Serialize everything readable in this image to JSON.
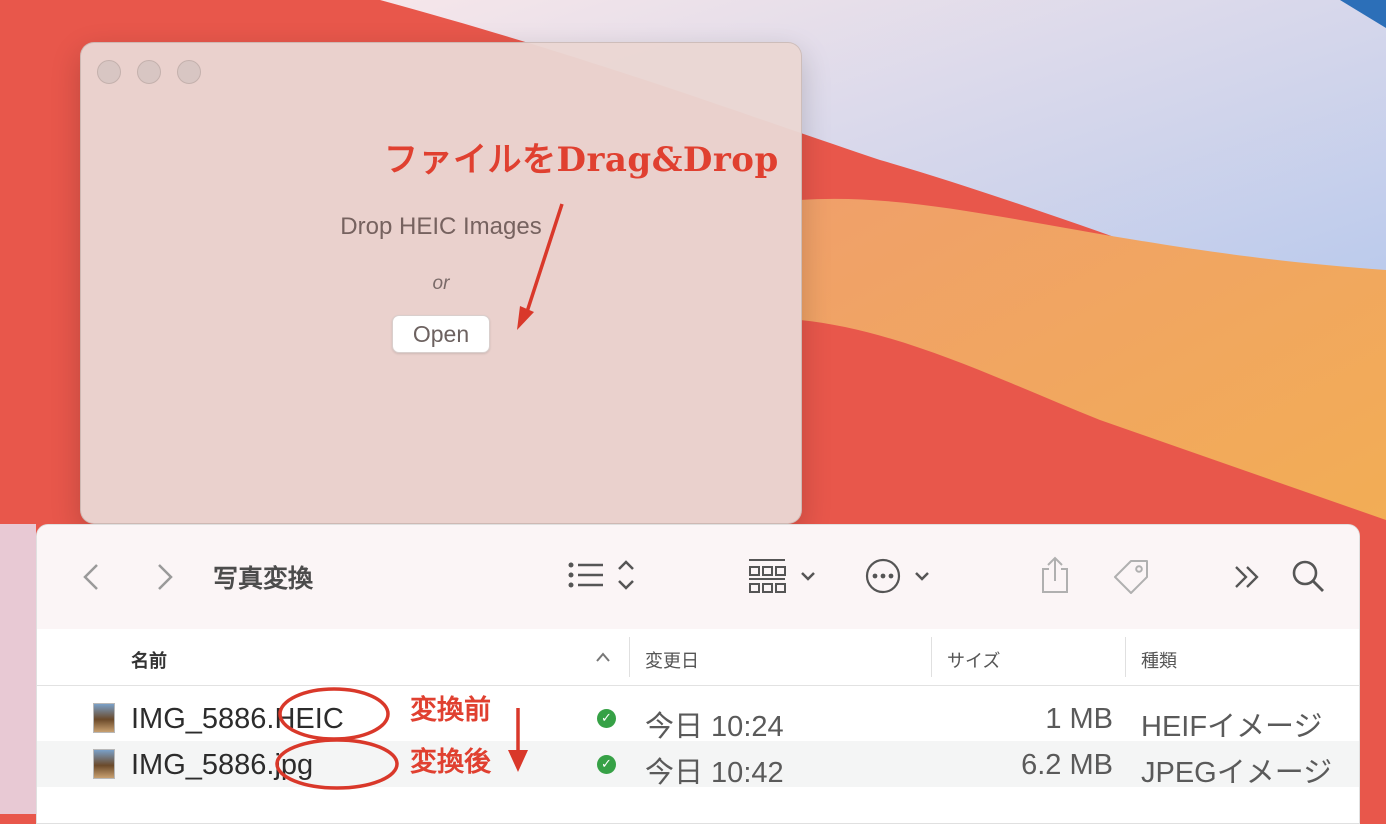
{
  "app_window": {
    "drop_label": "Drop HEIC Images",
    "or_label": "or",
    "open_label": "Open"
  },
  "annotations": {
    "drag_drop": "ファイルをDrag&Drop",
    "before": "変換前",
    "after": "変換後"
  },
  "finder": {
    "title": "写真変換",
    "icons": {
      "back": "chevron-left-icon",
      "forward": "chevron-right-icon",
      "view": "list-view-icon",
      "group": "grid-group-icon",
      "action": "ellipsis-circle-icon",
      "share": "share-icon",
      "tag": "tag-icon",
      "more": "double-chevron-right-icon",
      "search": "search-icon"
    },
    "columns": [
      "名前",
      "変更日",
      "サイズ",
      "種類"
    ],
    "rows": [
      {
        "name_base": "IMG_5886",
        "name_ext": ".HEIC",
        "date": "今日 10:24",
        "size": "1 MB",
        "kind": "HEIFイメージ"
      },
      {
        "name_base": "IMG_5886",
        "name_ext": ".jpg",
        "date": "今日 10:42",
        "size": "6.2 MB",
        "kind": "JPEGイメージ"
      }
    ]
  },
  "colors": {
    "annotation_red": "#e04030",
    "status_green": "#36a146"
  }
}
